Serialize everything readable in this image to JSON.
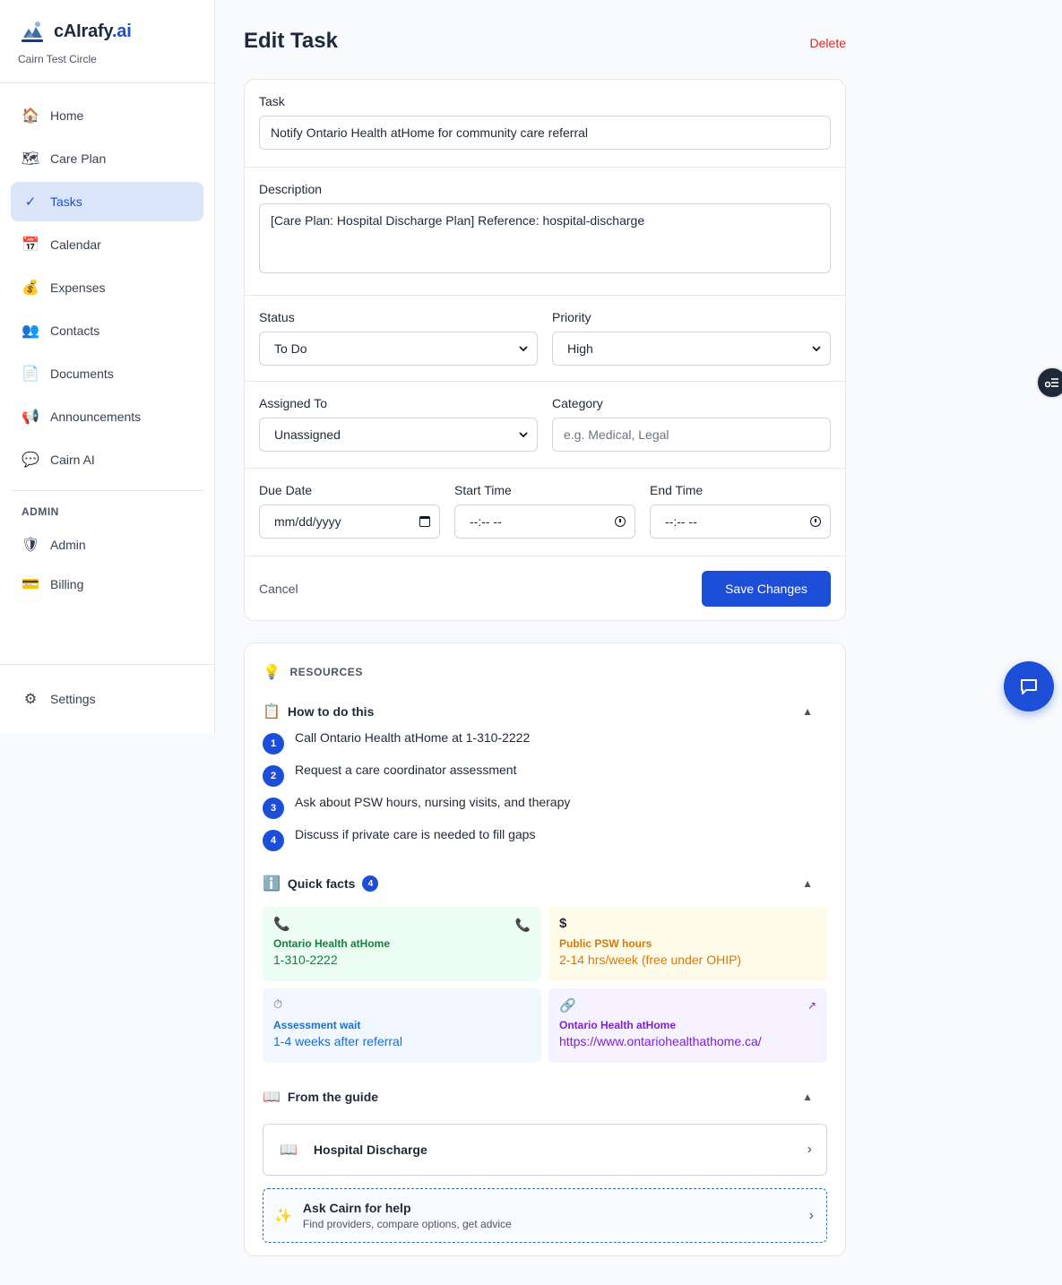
{
  "brand": {
    "name_main": "cAIrafy",
    "name_suffix": ".ai",
    "circle": "Cairn Test Circle"
  },
  "sidebar": {
    "items": [
      {
        "label": "Home",
        "icon": "house-icon"
      },
      {
        "label": "Care Plan",
        "icon": "map-icon"
      },
      {
        "label": "Tasks",
        "icon": "check-icon"
      },
      {
        "label": "Calendar",
        "icon": "calendar-icon"
      },
      {
        "label": "Expenses",
        "icon": "money-bag-icon"
      },
      {
        "label": "Contacts",
        "icon": "people-icon"
      },
      {
        "label": "Documents",
        "icon": "document-icon"
      },
      {
        "label": "Announcements",
        "icon": "megaphone-icon"
      },
      {
        "label": "Cairn AI",
        "icon": "speech-bubble-icon"
      }
    ],
    "admin_section": "ADMIN",
    "admin_items": [
      {
        "label": "Admin",
        "icon": "shield-icon"
      },
      {
        "label": "Billing",
        "icon": "credit-card-icon"
      }
    ],
    "settings": {
      "label": "Settings",
      "icon": "gear-icon"
    },
    "active_item": "Tasks"
  },
  "header": {
    "title": "Edit Task",
    "delete_label": "Delete"
  },
  "form": {
    "task_label": "Task",
    "task_value": "Notify Ontario Health atHome for community care referral",
    "description_label": "Description",
    "description_value": "[Care Plan: Hospital Discharge Plan] Reference: hospital-discharge",
    "status_label": "Status",
    "status_value": "To Do",
    "priority_label": "Priority",
    "priority_value": "High",
    "assigned_label": "Assigned To",
    "assigned_value": "Unassigned",
    "category_label": "Category",
    "category_placeholder": "e.g. Medical, Legal",
    "due_label": "Due Date",
    "due_placeholder": "mm/dd/yyyy",
    "start_label": "Start Time",
    "start_placeholder": "--:-- --",
    "end_label": "End Time",
    "end_placeholder": "--:-- --",
    "cancel_label": "Cancel",
    "save_label": "Save Changes"
  },
  "resources": {
    "title": "RESOURCES",
    "how_title": "How to do this",
    "steps": [
      {
        "num": "1",
        "text": "Call Ontario Health atHome at 1-310-2222"
      },
      {
        "num": "2",
        "text": "Request a care coordinator assessment"
      },
      {
        "num": "3",
        "text": "Ask about PSW hours, nursing visits, and therapy"
      },
      {
        "num": "4",
        "text": "Discuss if private care is needed to fill gaps"
      }
    ],
    "facts_title": "Quick facts",
    "facts_count": "4",
    "facts": [
      {
        "label": "Ontario Health atHome",
        "value": "1-310-2222",
        "icon": "phone-icon",
        "color": "#15803d"
      },
      {
        "label": "Public PSW hours",
        "value": "2-14 hrs/week (free under OHIP)",
        "icon": "dollar-icon",
        "color": "#d97706"
      },
      {
        "label": "Assessment wait",
        "value": "1-4 weeks after referral",
        "icon": "stopwatch-icon",
        "color": "#1d6fc5"
      },
      {
        "label": "Ontario Health atHome",
        "value": "https://www.ontariohealthathome.ca/",
        "icon": "link-icon",
        "color": "#7e22ce"
      }
    ],
    "guide_title": "From the guide",
    "guide_item": "Hospital Discharge",
    "ask_title": "Ask Cairn for help",
    "ask_sub": "Find providers, compare options, get advice"
  }
}
